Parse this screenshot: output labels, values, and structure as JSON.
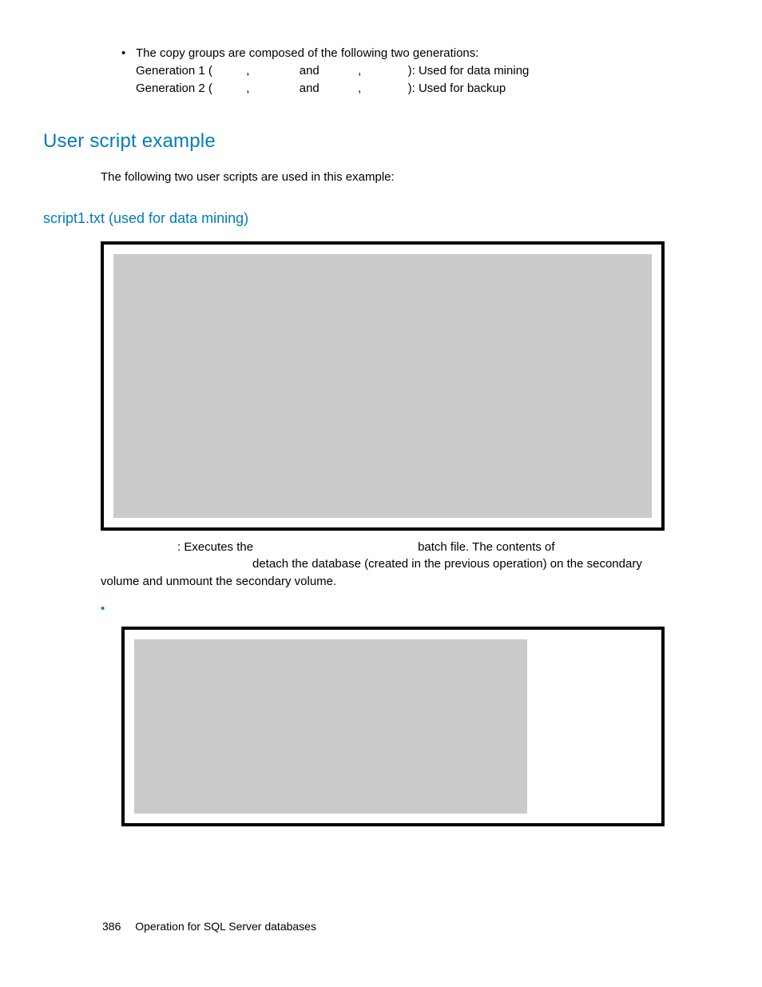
{
  "bullet": {
    "intro": "The copy groups are composed of the following two generations:",
    "gen1_prefix": "Generation 1 (",
    "gen2_prefix": "Generation 2 (",
    "comma": ",",
    "and": "and",
    "gen1_suffix": "): Used for data mining",
    "gen2_suffix": "): Used for backup"
  },
  "headings": {
    "h1": "User script example",
    "h2": "script1.txt (used for data mining)"
  },
  "intro_para": "The following two user scripts are used in this example:",
  "after_box": {
    "line1_a": ": Executes the",
    "line1_b": "batch file. The contents of",
    "line2": "detach the database (created in the previous operation) on the secondary volume and unmount the secondary volume."
  },
  "blue_bullet": "•",
  "footer": {
    "page": "386",
    "chapter": "Operation for SQL Server databases"
  }
}
